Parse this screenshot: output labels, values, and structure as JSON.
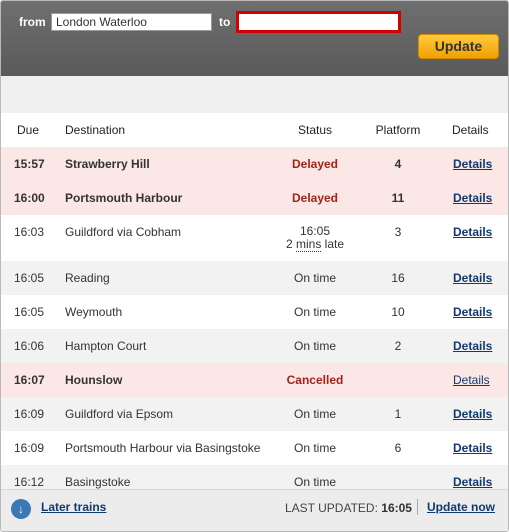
{
  "search": {
    "from_label": "from",
    "from_value": "London Waterloo",
    "to_label": "to",
    "to_value": "",
    "update_label": "Update"
  },
  "columns": {
    "due": "Due",
    "destination": "Destination",
    "status": "Status",
    "platform": "Platform",
    "details": "Details"
  },
  "rows": [
    {
      "due": "15:57",
      "destination": "Strawberry Hill",
      "status": "Delayed",
      "platform": "4",
      "details": "Details"
    },
    {
      "due": "16:00",
      "destination": "Portsmouth Harbour",
      "status": "Delayed",
      "platform": "11",
      "details": "Details"
    },
    {
      "due": "16:03",
      "destination": "Guildford via Cobham",
      "status": "16:05",
      "status_extra_prefix": "2 ",
      "status_extra_mins": "mins",
      "status_extra_suffix": " late",
      "platform": "3",
      "details": "Details"
    },
    {
      "due": "16:05",
      "destination": "Reading",
      "status": "On time",
      "platform": "16",
      "details": "Details"
    },
    {
      "due": "16:05",
      "destination": "Weymouth",
      "status": "On time",
      "platform": "10",
      "details": "Details"
    },
    {
      "due": "16:06",
      "destination": "Hampton Court",
      "status": "On time",
      "platform": "2",
      "details": "Details"
    },
    {
      "due": "16:07",
      "destination": "Hounslow",
      "status": "Cancelled",
      "platform": "",
      "details": "Details"
    },
    {
      "due": "16:09",
      "destination": "Guildford via Epsom",
      "status": "On time",
      "platform": "1",
      "details": "Details"
    },
    {
      "due": "16:09",
      "destination": "Portsmouth Harbour via Basingstoke",
      "status": "On time",
      "platform": "6",
      "details": "Details"
    },
    {
      "due": "16:12",
      "destination": "Basingstoke",
      "status": "On time",
      "platform": "",
      "details": "Details"
    }
  ],
  "footer": {
    "later_trains": "Later trains",
    "last_updated_label": "LAST UPDATED:",
    "last_updated_time": "16:05",
    "update_now": "Update now"
  },
  "icons": {
    "later_trains_icon": "chevron-down-circle-icon"
  },
  "colors": {
    "header_bg": "#666666",
    "alert_row_bg": "#fbe7e6",
    "alert_text": "#a0231c",
    "link": "#113a70",
    "update_button": "#f9b820",
    "input_error_border": "#d40000"
  }
}
